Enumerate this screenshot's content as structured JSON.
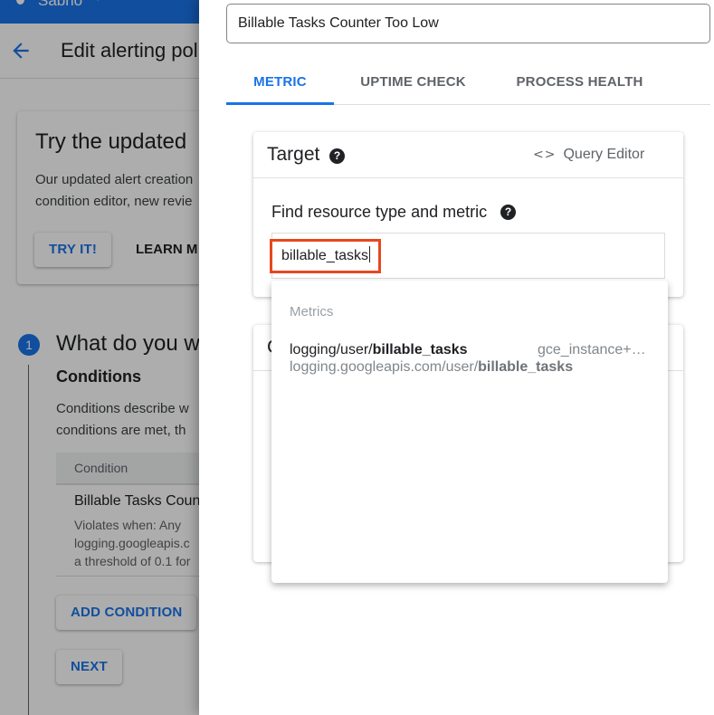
{
  "background": {
    "project_selector": {
      "label": "Sabrio"
    },
    "page_title": "Edit alerting policy",
    "promo": {
      "title": "Try the updated",
      "text_line1": "Our updated alert creation",
      "text_line2": "condition editor, new revie",
      "try_button": "TRY IT!",
      "learn_button": "LEARN M"
    },
    "step": {
      "number": "1",
      "title": "What do you w",
      "conditions_heading": "Conditions",
      "desc_line1": "Conditions describe w",
      "desc_line2": "conditions are met, th",
      "table": {
        "header": "Condition",
        "rows": [
          {
            "name": "Billable Tasks Coun",
            "detail_line1": "Violates when: Any",
            "detail_line2": "logging.googleapis.c",
            "detail_line3": "a threshold of 0.1 for"
          }
        ]
      },
      "add_condition_button": "ADD CONDITION",
      "next_button": "NEXT"
    }
  },
  "panel": {
    "condition_name": "Billable Tasks Counter Too Low",
    "tabs": [
      {
        "label": "METRIC",
        "active": true
      },
      {
        "label": "UPTIME CHECK",
        "active": false
      },
      {
        "label": "PROCESS HEALTH",
        "active": false
      }
    ],
    "target": {
      "title": "Target",
      "help_icon": "help-circle-icon",
      "query_editor_icon": "code-icon",
      "query_editor_label": "Query Editor",
      "find_label": "Find resource type and metric",
      "search_value": "billable_tasks"
    },
    "second_card": {
      "title_partial": "C"
    },
    "dropdown": {
      "section_label": "Metrics",
      "items": [
        {
          "primary_prefix": "logging/user/",
          "primary_match": "billable_tasks",
          "secondary_prefix": "logging.googleapis.com/user/",
          "secondary_match": "billable_tasks",
          "resource": "gce_instance+…"
        }
      ]
    }
  },
  "colors": {
    "accent": "#1a73e8",
    "highlight_border": "#e8461e",
    "overlay": "rgba(0,0,0,0.32)"
  }
}
